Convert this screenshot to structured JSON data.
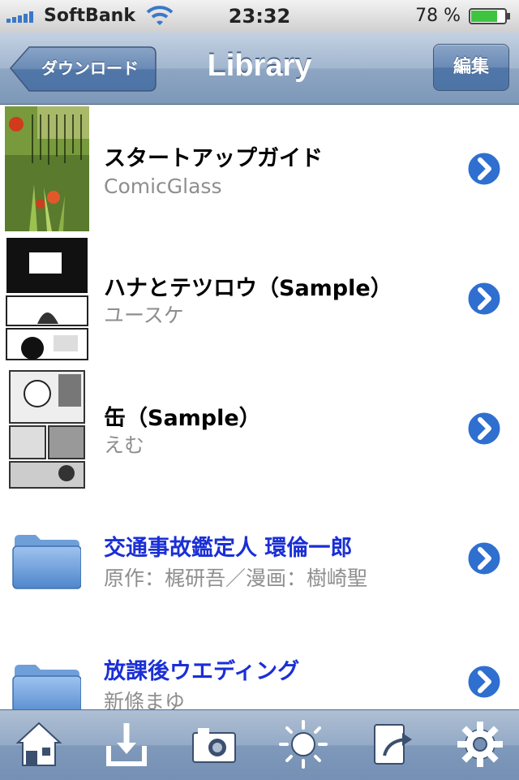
{
  "status": {
    "carrier": "SoftBank",
    "time": "23:32",
    "battery": "78 %",
    "battery_level": 0.78
  },
  "nav": {
    "back_label": "ダウンロード",
    "title": "Library",
    "edit_label": "編集"
  },
  "items": [
    {
      "title": "スタートアップガイド",
      "subtitle": "ComicGlass",
      "kind": "book",
      "thumb": "flower-photo"
    },
    {
      "title": "ハナとテツロウ（Sample）",
      "subtitle": "ユースケ",
      "kind": "book",
      "thumb": "manga-page"
    },
    {
      "title": "缶（Sample）",
      "subtitle": "えむ",
      "kind": "book",
      "thumb": "manga-page"
    },
    {
      "title": "交通事故鑑定人 環倫一郎",
      "subtitle": "原作：梶研吾／漫画：樹崎聖",
      "kind": "folder"
    },
    {
      "title": "放課後ウエディング",
      "subtitle": "新條まゆ",
      "kind": "folder"
    }
  ],
  "tabs": [
    {
      "icon": "home-icon"
    },
    {
      "icon": "download-icon"
    },
    {
      "icon": "camera-icon"
    },
    {
      "icon": "brightness-icon"
    },
    {
      "icon": "export-icon"
    },
    {
      "icon": "gear-icon"
    }
  ],
  "colors": {
    "folder_title": "#1a2fd6",
    "subtitle": "#8e8e8e",
    "disclosure": "#2f6fd0"
  }
}
